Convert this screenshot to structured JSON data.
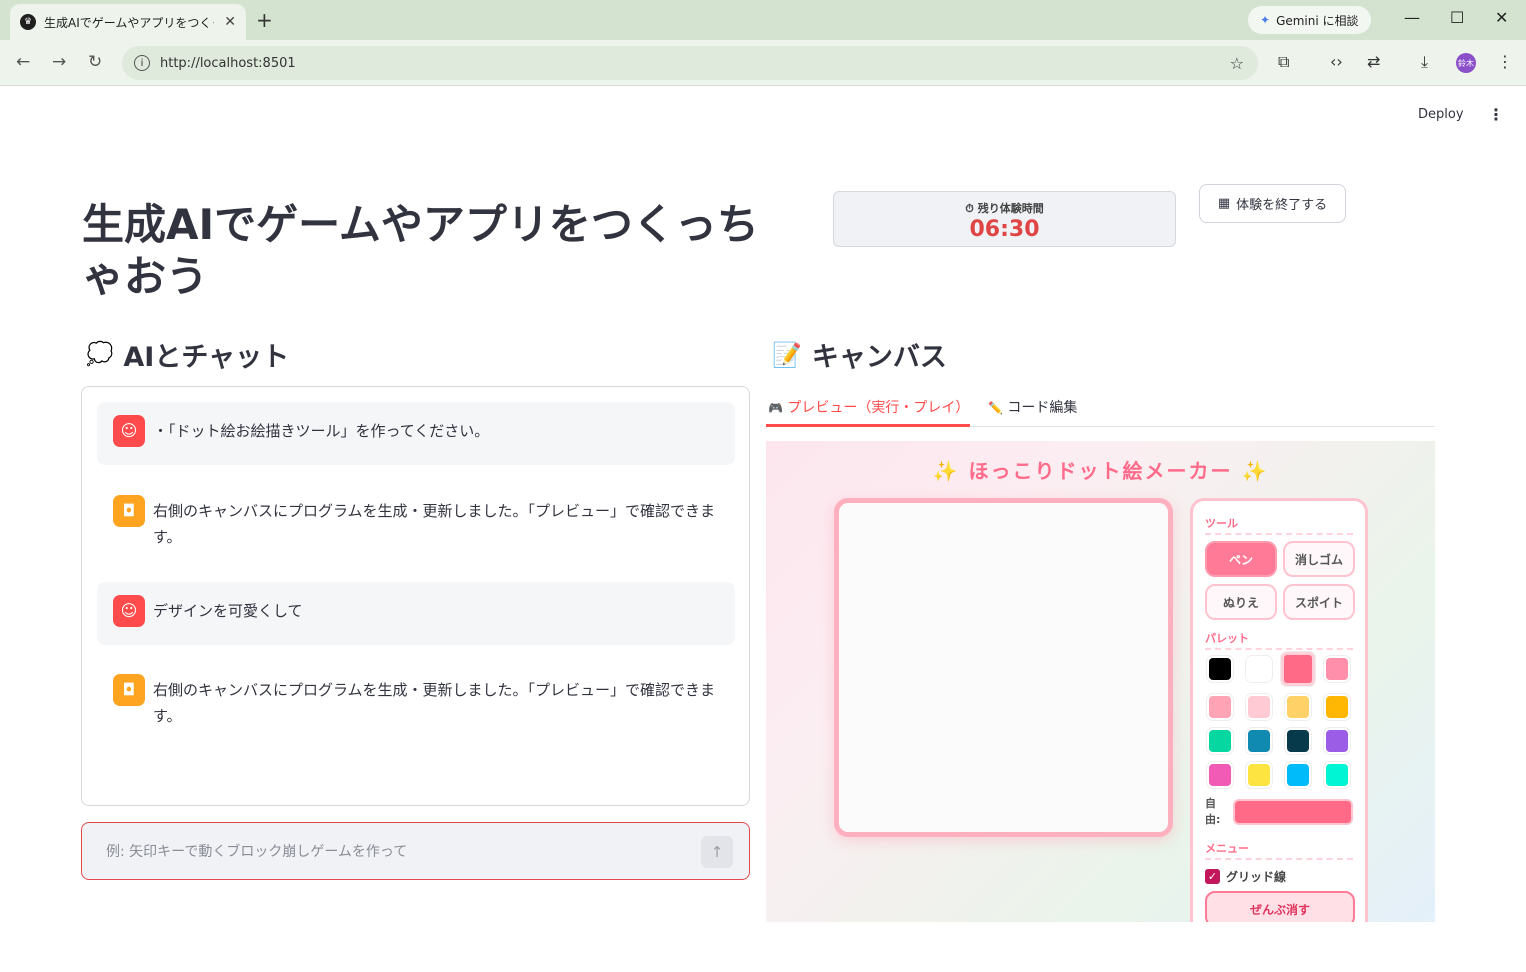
{
  "browser": {
    "tab_title": "生成AIでゲームやアプリをつくっちゃお",
    "gemini_label": "Gemini に相談",
    "url": "http://localhost:8501",
    "avatar_text": "鈴木"
  },
  "app": {
    "deploy_label": "Deploy",
    "title": "生成AIでゲームやアプリをつくっちゃおう",
    "timer_label": "⏱ 残り体験時間",
    "timer_value": "06:30",
    "end_button": "体験を終了する",
    "end_icon": "▦"
  },
  "chat": {
    "heading": "AIとチャット",
    "heading_icon": "💭",
    "messages": [
      {
        "role": "user",
        "text": "・「ドット絵お絵描きツール」を作ってください。"
      },
      {
        "role": "assistant",
        "text": "右側のキャンバスにプログラムを生成・更新しました。「プレビュー」で確認できます。"
      },
      {
        "role": "user",
        "text": "デザインを可愛くして"
      },
      {
        "role": "assistant",
        "text": "右側のキャンバスにプログラムを生成・更新しました。「プレビュー」で確認できます。"
      }
    ],
    "input_placeholder": "例: 矢印キーで動くブロック崩しゲームを作って"
  },
  "canvas": {
    "heading": "キャンバス",
    "heading_icon": "📝",
    "tabs": [
      {
        "label": "プレビュー（実行・プレイ）",
        "icon": "🎮",
        "active": true
      },
      {
        "label": "コード編集",
        "icon": "✏️",
        "active": false
      }
    ]
  },
  "pixel_app": {
    "title": "ほっこりドット絵メーカー",
    "sparkle": "✨",
    "tools_label": "ツール",
    "tools": [
      {
        "label": "ペン",
        "active": true
      },
      {
        "label": "消しゴム",
        "active": false
      },
      {
        "label": "ぬりえ",
        "active": false
      },
      {
        "label": "スポイト",
        "active": false
      }
    ],
    "palette_label": "パレット",
    "palette": [
      "#000000",
      "#ffffff",
      "#ff6b86",
      "#ff8fab",
      "#ffa3b5",
      "#ffcad4",
      "#ffd166",
      "#ffb703",
      "#06d6a0",
      "#118ab2",
      "#073b4c",
      "#9b5de5",
      "#f15bb5",
      "#fee440",
      "#00bbf9",
      "#00f5d4"
    ],
    "selected_color_index": 2,
    "free_label": "自由:",
    "free_color": "#ff6b86",
    "menu_label": "メニュー",
    "grid_label": "グリッド線",
    "grid_checked": true,
    "clear_label": "ぜんぶ消す"
  }
}
